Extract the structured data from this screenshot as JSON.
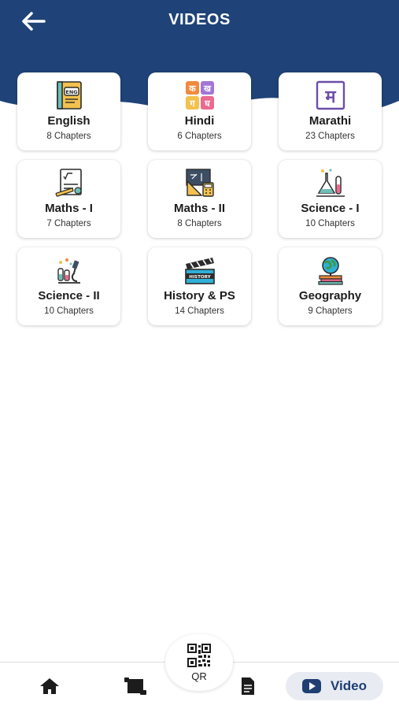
{
  "header": {
    "title": "VIDEOS",
    "back_icon": "arrow-left-icon",
    "background": "#1f4378"
  },
  "subjects": [
    {
      "name": "English",
      "chapters": "8 Chapters",
      "icon": "english-book-icon"
    },
    {
      "name": "Hindi",
      "chapters": "6 Chapters",
      "icon": "hindi-letters-icon"
    },
    {
      "name": "Marathi",
      "chapters": "23 Chapters",
      "icon": "marathi-letter-icon"
    },
    {
      "name": "Maths - I",
      "chapters": "7 Chapters",
      "icon": "maths-formula-icon"
    },
    {
      "name": "Maths - II",
      "chapters": "8 Chapters",
      "icon": "geometry-tools-icon"
    },
    {
      "name": "Science - I",
      "chapters": "10 Chapters",
      "icon": "lab-flasks-icon"
    },
    {
      "name": "Science - II",
      "chapters": "10 Chapters",
      "icon": "microscope-icon"
    },
    {
      "name": "History & PS",
      "chapters": "14 Chapters",
      "icon": "history-clapperboard-icon"
    },
    {
      "name": "Geography",
      "chapters": "9 Chapters",
      "icon": "globe-books-icon"
    }
  ],
  "hindi_icon_letters": [
    "क",
    "ख",
    "ग",
    "घ"
  ],
  "marathi_icon_letter": "म",
  "english_icon_text": "ENG",
  "history_icon_text": "HISTORY",
  "bottom_nav": {
    "home_icon": "home-icon",
    "book_icon": "book-scroll-icon",
    "doc_icon": "document-icon",
    "qr_label": "QR",
    "video_label": "Video",
    "video_icon": "play-button-icon",
    "active": "Video"
  },
  "colors": {
    "accent": "#1f4378",
    "active_pill": "#e8ebf2",
    "active_text": "#1f3f72"
  }
}
